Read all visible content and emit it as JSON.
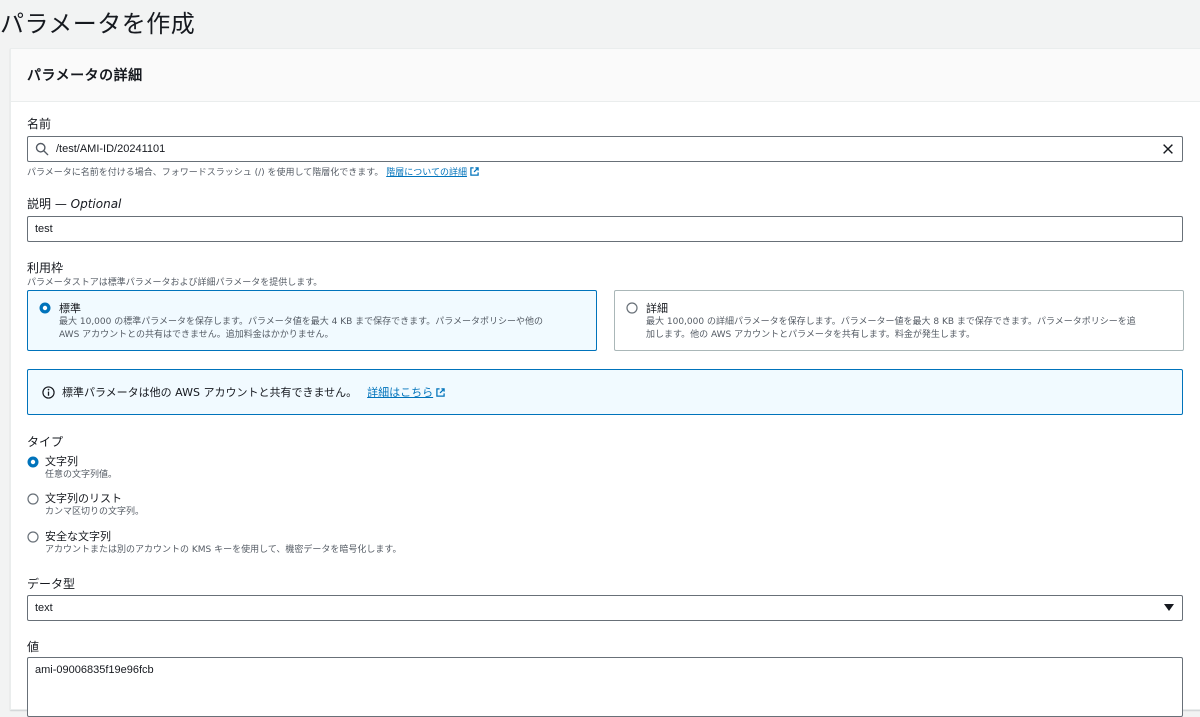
{
  "page_title": "パラメータを作成",
  "panel": {
    "title": "パラメータの詳細"
  },
  "name_field": {
    "label": "名前",
    "value": "/test/AMI-ID/20241101",
    "hint": "パラメータに名前を付ける場合、フォワードスラッシュ (/) を使用して階層化できます。",
    "hint_link": "階層についての詳細"
  },
  "description_field": {
    "label": "説明 — ",
    "optional": "Optional",
    "value": "test"
  },
  "tier": {
    "label": "利用枠",
    "description": "パラメータストアは標準パラメータおよび詳細パラメータを提供します。",
    "options": [
      {
        "title": "標準",
        "desc_line1": "最大 10,000 の標準パラメータを保存します。パラメータ値を最大 4 KB まで保存できます。パラメータポリシーや他の",
        "desc_line2": "AWS アカウントとの共有はできません。追加料金はかかりません。",
        "selected": true
      },
      {
        "title": "詳細",
        "desc_line1": "最大 100,000 の詳細パラメータを保存します。パラメーター値を最大 8 KB まで保存できます。パラメータポリシーを追",
        "desc_line2": "加します。他の AWS アカウントとパラメータを共有します。料金が発生します。",
        "selected": false
      }
    ]
  },
  "alert": {
    "text": "標準パラメータは他の AWS アカウントと共有できません。",
    "link": "詳細はこちら"
  },
  "type": {
    "label": "タイプ",
    "options": [
      {
        "title": "文字列",
        "desc": "任意の文字列値。",
        "selected": true
      },
      {
        "title": "文字列のリスト",
        "desc": "カンマ区切りの文字列。",
        "selected": false
      },
      {
        "title": "安全な文字列",
        "desc": "アカウントまたは別のアカウントの KMS キーを使用して、機密データを暗号化します。",
        "selected": false
      }
    ]
  },
  "data_type": {
    "label": "データ型",
    "value": "text"
  },
  "value_field": {
    "label": "値",
    "value": "ami-09006835f19e96fcb"
  },
  "icons": {
    "search": "search-icon",
    "clear": "close-icon",
    "external": "external-link-icon",
    "info": "info-icon",
    "caret": "caret-down-icon"
  },
  "colors": {
    "accent": "#0073bb",
    "selected_bg": "#f1faff",
    "page_bg": "#f2f3f3",
    "text_secondary": "#545b64"
  }
}
